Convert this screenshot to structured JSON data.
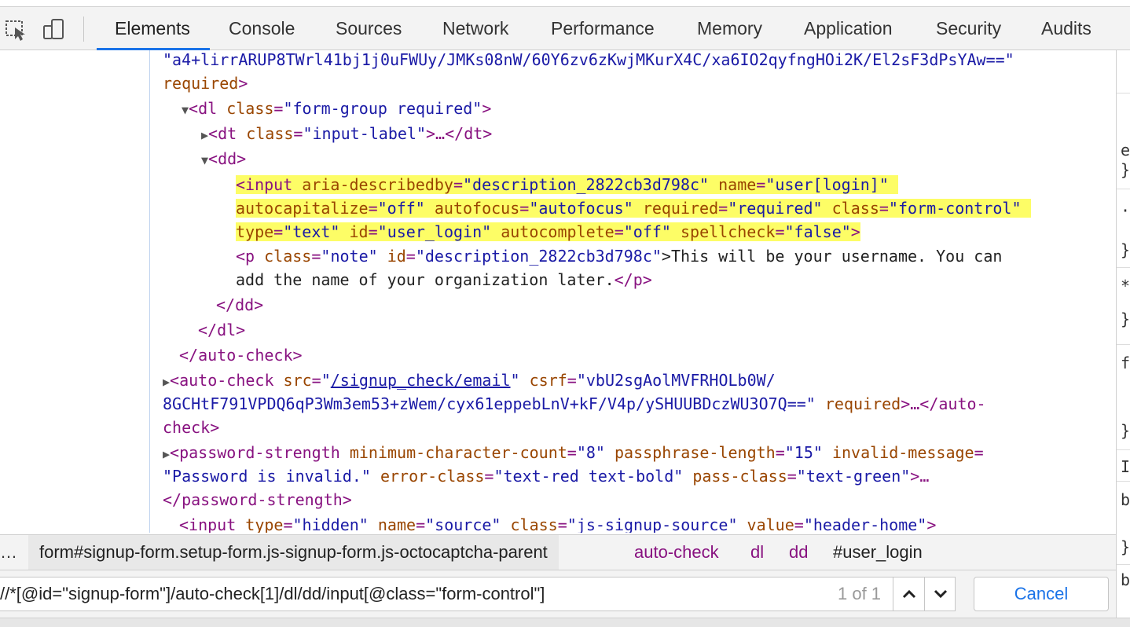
{
  "toolbar": {
    "tabs": [
      {
        "label": "Elements"
      },
      {
        "label": "Console"
      },
      {
        "label": "Sources"
      },
      {
        "label": "Network"
      },
      {
        "label": "Performance"
      },
      {
        "label": "Memory"
      },
      {
        "label": "Application"
      },
      {
        "label": "Security"
      },
      {
        "label": "Audits"
      }
    ],
    "active_tab": "Elements",
    "accent_color": "#1a73e8"
  },
  "tree": {
    "l0_val": "\"a4+lirrARUP8TWrl41bj1j0uFWUy/JMKs08nW/60Y6zv6zKwjMKurX4C/xa6IO2qyfngHOi2K/El2sF3dPsYAw==\"",
    "l1_attr": "required",
    "l1_close": ">",
    "l2_tag": "<dl",
    "l2_attr": "class",
    "l2_val": "\"form-group required\"",
    "l2_close": ">",
    "l3_tag": "<dt",
    "l3_attr": "class",
    "l3_val": "\"input-label\"",
    "l3_ellipsis": ">…",
    "l3_close": "</dt>",
    "l4_tag": "<dd>",
    "l5_tag": "<input",
    "l5_a1": "aria-describedby",
    "l5_v1": "\"description_2822cb3d798c\"",
    "l5_a2": "name",
    "l5_v2": "\"user[login]\"",
    "l6_a1": "autocapitalize",
    "l6_v1": "\"off\"",
    "l6_a2": "autofocus",
    "l6_v2": "\"autofocus\"",
    "l6_a3": "required",
    "l6_v3": "\"required\"",
    "l6_a4": "class",
    "l6_v4": "\"form-control\"",
    "l7_a1": "type",
    "l7_v1": "\"text\"",
    "l7_a2": "id",
    "l7_v2": "\"user_login\"",
    "l7_a3": "autocomplete",
    "l7_v3": "\"off\"",
    "l7_a4": "spellcheck",
    "l7_v4": "\"false\"",
    "l7_close": ">",
    "l8_tag": "<p",
    "l8_a1": "class",
    "l8_v1": "\"note\"",
    "l8_a2": "id",
    "l8_v2": "\"description_2822cb3d798c\"",
    "l8_text": ">This will be your username. You can",
    "l9_text": "add the name of your organization later.",
    "l9_close": "</p>",
    "l10_tag": "</dd>",
    "l11_tag": "</dl>",
    "l12_tag": "</auto-check>",
    "l13_tag": "<auto-check",
    "l13_a1": "src",
    "l13_link": "/signup_check/email",
    "l13_a2": "csrf",
    "l13_v2": "\"vbU2sgAolMVFRHOLb0W/",
    "l14_v": "8GCHtF791VPDQ6qP3Wm3em53+zWem/cyx61eppebLnV+kF/V4p/ySHUUBDczWU3O7Q==\"",
    "l14_attr": "required",
    "l14_close": ">…</auto-",
    "l15_close": "check>",
    "l16_tag": "<password-strength",
    "l16_a1": "minimum-character-count",
    "l16_v1": "\"8\"",
    "l16_a2": "passphrase-length",
    "l16_v2": "\"15\"",
    "l16_a3": "invalid-message",
    "l17_v1": "\"Password is invalid.\"",
    "l17_a2": "error-class",
    "l17_v2": "\"text-red text-bold\"",
    "l17_a3": "pass-class",
    "l17_v3": "\"text-green\"",
    "l17_close": ">…",
    "l18_tag": "</password-strength>",
    "l19_tag": "<input",
    "l19_a1": "type",
    "l19_v1": "\"hidden\"",
    "l19_a2": "name",
    "l19_v2": "\"source\"",
    "l19_a3": "class",
    "l19_v3": "\"js-signup-source\"",
    "l19_a4": "value",
    "l19_v4": "\"header-home\"",
    "l19_close": ">"
  },
  "breadcrumb": {
    "ellipsis": "…",
    "items": [
      "form#signup-form.setup-form.js-signup-form.js-octocaptcha-parent",
      "auto-check",
      "dl",
      "dd",
      "#user_login"
    ]
  },
  "search": {
    "query": "//*[@id=\"signup-form\"]/auto-check[1]/dl/dd/input[@class=\"form-control\"]",
    "match_count": "1 of 1",
    "cancel_label": "Cancel"
  },
  "side_glyphs": [
    "e",
    "}",
    "·",
    "}",
    "*",
    "}",
    "f",
    "}",
    "I",
    "b",
    "}",
    "b"
  ]
}
